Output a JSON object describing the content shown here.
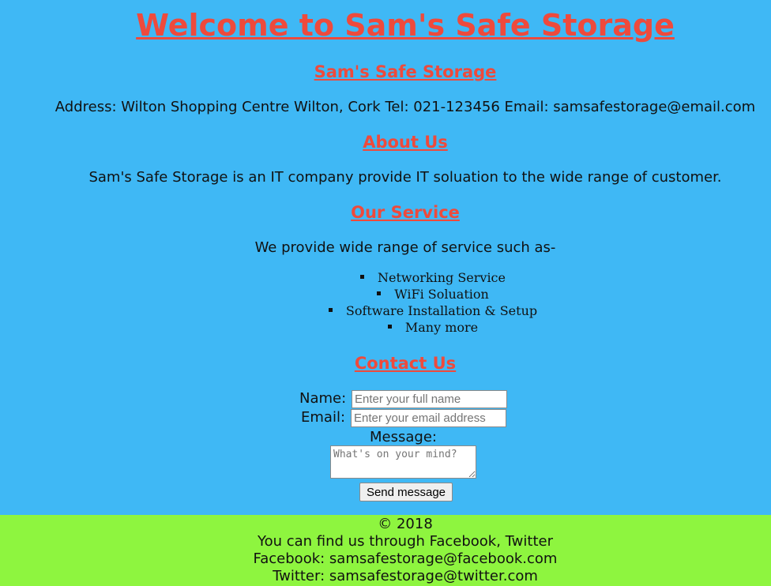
{
  "header": {
    "title": "Welcome to Sam's Safe Storage",
    "subtitle": "Sam's Safe Storage",
    "contact_line": "Address: Wilton Shopping Centre Wilton, Cork Tel: 021-123456 Email: samsafestorage@email.com"
  },
  "about": {
    "heading": "About Us",
    "text": "Sam's Safe Storage is an IT company provide IT soluation to the wide range of customer."
  },
  "services": {
    "heading": "Our Service",
    "intro": "We provide wide range of service such as-",
    "items": [
      "Networking Service",
      "WiFi Soluation",
      "Software Installation & Setup",
      "Many more"
    ]
  },
  "contact": {
    "heading": "Contact Us",
    "name_label": "Name:",
    "name_placeholder": "Enter your full name",
    "email_label": "Email:",
    "email_placeholder": "Enter your email address",
    "message_label": "Message:",
    "message_placeholder": "What's on your mind?",
    "send_label": "Send message"
  },
  "footer": {
    "copyright": "© 2018",
    "social_line": "You can find us through Facebook, Twitter",
    "facebook": "Facebook: samsafestorage@facebook.com",
    "twitter": "Twitter: samsafestorage@twitter.com"
  },
  "colors": {
    "page_background": "#3fb8f5",
    "heading": "#ee4a3c",
    "footer_background": "#8ef53f"
  }
}
